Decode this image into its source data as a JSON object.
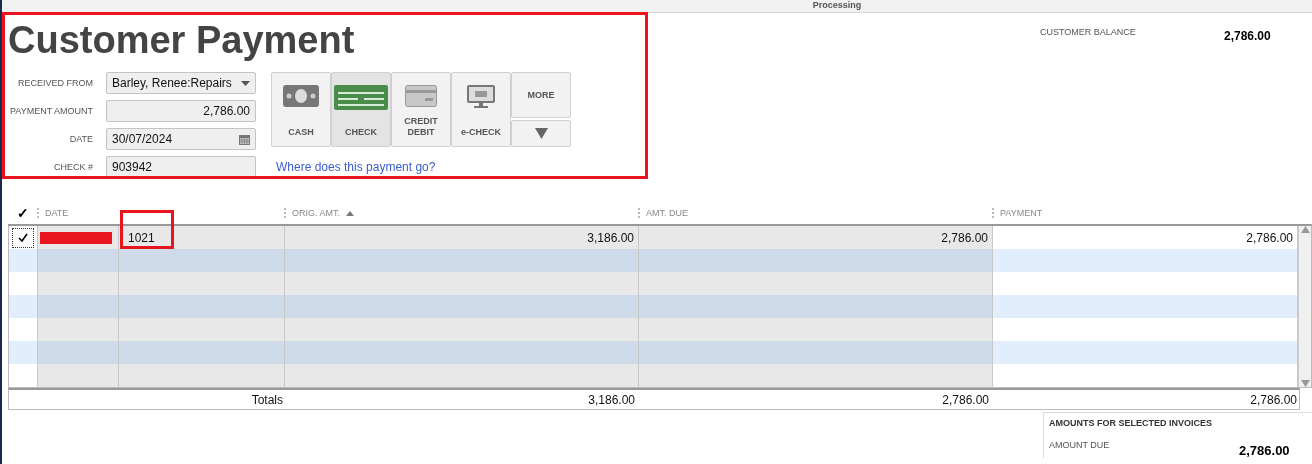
{
  "top_bar": {
    "title": "Processing"
  },
  "title": "Customer Payment",
  "form": [
    {
      "label": "RECEIVED FROM",
      "kind": "dropdown",
      "value": "Barley, Renee:Repairs"
    },
    {
      "label": "PAYMENT AMOUNT",
      "kind": "amount",
      "value": "2,786.00"
    },
    {
      "label": "DATE",
      "kind": "date",
      "value": "30/07/2024"
    },
    {
      "label": "CHECK #",
      "kind": "text",
      "value": "903942"
    }
  ],
  "payment_methods": [
    {
      "label": "CASH",
      "kind": "cash",
      "selected": false
    },
    {
      "label": "CHECK",
      "kind": "check",
      "selected": true
    },
    {
      "label": "CREDIT DEBIT",
      "kind": "card",
      "selected": false
    },
    {
      "label": "e-CHECK",
      "kind": "echeck",
      "selected": false
    }
  ],
  "more_button": "MORE",
  "help_link": "Where does this payment go?",
  "customer_balance": {
    "label": "CUSTOMER BALANCE",
    "value": "2,786.00"
  },
  "table": {
    "check_column": "✓",
    "columns": [
      {
        "label": "DATE",
        "sorted": false
      },
      {
        "highlighted": true
      },
      {
        "label": "ORIG. AMT.",
        "sorted": true
      },
      {
        "label": "AMT. DUE",
        "sorted": false
      },
      {
        "label": "PAYMENT",
        "sorted": false
      }
    ],
    "rows": [
      {
        "checked": true,
        "date_redacted": true,
        "cells": [
          "",
          "1021",
          "3,186.00",
          "2,786.00",
          "2,786.00"
        ]
      }
    ],
    "totals": {
      "label": "Totals",
      "values": [
        "3,186.00",
        "2,786.00",
        "2,786.00"
      ]
    }
  },
  "header_highlighted": true,
  "selected_invoices": {
    "title": "AMOUNTS FOR SELECTED INVOICES",
    "label": "AMOUNT DUE",
    "value": "2,786.00"
  }
}
